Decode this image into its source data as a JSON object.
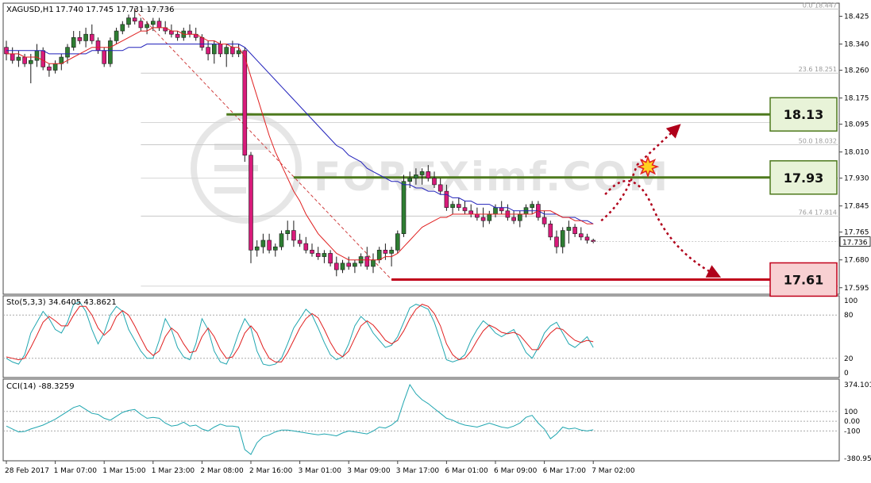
{
  "chart_data": {
    "type": "candlestick",
    "symbol": "XAGUSD,H1",
    "ohlc_header": "17.740 17.745 17.731 17.736",
    "price_axis": {
      "ylim": [
        17.575,
        18.465
      ],
      "ticks": [
        "18.425",
        "18.340",
        "18.260",
        "18.175",
        "18.095",
        "18.010",
        "17.930",
        "17.845",
        "17.765",
        "17.680",
        "17.595"
      ],
      "tick_values": [
        18.425,
        18.34,
        18.26,
        18.175,
        18.095,
        18.01,
        17.93,
        17.845,
        17.765,
        17.68,
        17.595
      ]
    },
    "current_price": {
      "label": "17.736",
      "value": 17.736
    },
    "fibonacci_levels": [
      {
        "label": "0.0  18.447",
        "value": 18.447
      },
      {
        "label": "23.6  18.251",
        "value": 18.251
      },
      {
        "label": "50.0  18.032",
        "value": 18.032
      },
      {
        "label": "76.4  17.814",
        "value": 17.814
      }
    ],
    "key_levels": [
      {
        "label": "18.13",
        "value": 18.125,
        "color": "#4e7a1e",
        "box_bg": "#e8f3d8"
      },
      {
        "label": "17.93",
        "value": 17.932,
        "color": "#4e7a1e",
        "box_bg": "#e8f3d8"
      },
      {
        "label": "17.61",
        "value": 17.62,
        "color": "#c0001a",
        "box_bg": "#f8d0d2"
      }
    ],
    "time_axis": {
      "labels": [
        "28 Feb 2017",
        "1 Mar 07:00",
        "1 Mar 15:00",
        "1 Mar 23:00",
        "2 Mar 08:00",
        "2 Mar 16:00",
        "3 Mar 01:00",
        "3 Mar 09:00",
        "3 Mar 17:00",
        "6 Mar 01:00",
        "6 Mar 09:00",
        "6 Mar 17:00",
        "7 Mar 02:00"
      ],
      "bar_index": [
        0,
        8,
        16,
        24,
        32,
        40,
        48,
        56,
        64,
        72,
        80,
        88,
        96
      ]
    },
    "candles": [
      [
        18.33,
        18.35,
        18.29,
        18.31
      ],
      [
        18.31,
        18.33,
        18.28,
        18.29
      ],
      [
        18.29,
        18.32,
        18.27,
        18.3
      ],
      [
        18.3,
        18.31,
        18.27,
        18.28
      ],
      [
        18.28,
        18.31,
        18.22,
        18.29
      ],
      [
        18.29,
        18.34,
        18.27,
        18.32
      ],
      [
        18.32,
        18.33,
        18.26,
        18.27
      ],
      [
        18.27,
        18.28,
        18.24,
        18.26
      ],
      [
        18.26,
        18.29,
        18.25,
        18.28
      ],
      [
        18.28,
        18.31,
        18.26,
        18.3
      ],
      [
        18.3,
        18.34,
        18.28,
        18.33
      ],
      [
        18.33,
        18.38,
        18.32,
        18.36
      ],
      [
        18.36,
        18.38,
        18.34,
        18.35
      ],
      [
        18.35,
        18.39,
        18.33,
        18.37
      ],
      [
        18.37,
        18.4,
        18.34,
        18.35
      ],
      [
        18.35,
        18.36,
        18.31,
        18.32
      ],
      [
        18.32,
        18.33,
        18.27,
        18.28
      ],
      [
        18.28,
        18.36,
        18.27,
        18.35
      ],
      [
        18.35,
        18.39,
        18.34,
        18.38
      ],
      [
        18.38,
        18.41,
        18.37,
        18.4
      ],
      [
        18.4,
        18.43,
        18.39,
        18.42
      ],
      [
        18.42,
        18.45,
        18.4,
        18.41
      ],
      [
        18.41,
        18.42,
        18.38,
        18.39
      ],
      [
        18.39,
        18.41,
        18.37,
        18.4
      ],
      [
        18.4,
        18.42,
        18.38,
        18.41
      ],
      [
        18.41,
        18.42,
        18.38,
        18.39
      ],
      [
        18.39,
        18.41,
        18.37,
        18.38
      ],
      [
        18.38,
        18.4,
        18.36,
        18.37
      ],
      [
        18.37,
        18.38,
        18.35,
        18.36
      ],
      [
        18.36,
        18.39,
        18.35,
        18.38
      ],
      [
        18.38,
        18.4,
        18.36,
        18.37
      ],
      [
        18.37,
        18.39,
        18.35,
        18.36
      ],
      [
        18.36,
        18.37,
        18.32,
        18.33
      ],
      [
        18.33,
        18.35,
        18.29,
        18.31
      ],
      [
        18.31,
        18.35,
        18.28,
        18.34
      ],
      [
        18.34,
        18.35,
        18.3,
        18.31
      ],
      [
        18.31,
        18.34,
        18.27,
        18.33
      ],
      [
        18.33,
        18.35,
        18.3,
        18.31
      ],
      [
        18.31,
        18.34,
        18.3,
        18.32
      ],
      [
        18.32,
        18.33,
        17.98,
        18.0
      ],
      [
        18.0,
        18.01,
        17.67,
        17.71
      ],
      [
        17.71,
        17.74,
        17.69,
        17.72
      ],
      [
        17.72,
        17.76,
        17.7,
        17.74
      ],
      [
        17.74,
        17.76,
        17.7,
        17.71
      ],
      [
        17.71,
        17.73,
        17.69,
        17.72
      ],
      [
        17.72,
        17.77,
        17.71,
        17.76
      ],
      [
        17.76,
        17.8,
        17.74,
        17.77
      ],
      [
        17.77,
        17.8,
        17.72,
        17.74
      ],
      [
        17.74,
        17.76,
        17.72,
        17.73
      ],
      [
        17.73,
        17.75,
        17.7,
        17.71
      ],
      [
        17.71,
        17.73,
        17.69,
        17.7
      ],
      [
        17.7,
        17.72,
        17.68,
        17.69
      ],
      [
        17.69,
        17.71,
        17.67,
        17.7
      ],
      [
        17.7,
        17.71,
        17.66,
        17.67
      ],
      [
        17.67,
        17.69,
        17.63,
        17.65
      ],
      [
        17.65,
        17.68,
        17.64,
        17.67
      ],
      [
        17.67,
        17.69,
        17.65,
        17.66
      ],
      [
        17.66,
        17.68,
        17.64,
        17.67
      ],
      [
        17.67,
        17.7,
        17.66,
        17.69
      ],
      [
        17.69,
        17.72,
        17.65,
        17.66
      ],
      [
        17.66,
        17.7,
        17.64,
        17.68
      ],
      [
        17.68,
        17.72,
        17.67,
        17.71
      ],
      [
        17.71,
        17.73,
        17.68,
        17.7
      ],
      [
        17.7,
        17.72,
        17.66,
        17.71
      ],
      [
        17.71,
        17.77,
        17.7,
        17.76
      ],
      [
        17.76,
        17.94,
        17.75,
        17.92
      ],
      [
        17.92,
        17.95,
        17.9,
        17.93
      ],
      [
        17.93,
        17.96,
        17.91,
        17.94
      ],
      [
        17.94,
        17.96,
        17.91,
        17.95
      ],
      [
        17.95,
        17.97,
        17.92,
        17.93
      ],
      [
        17.93,
        17.95,
        17.9,
        17.91
      ],
      [
        17.91,
        17.93,
        17.88,
        17.89
      ],
      [
        17.89,
        17.91,
        17.83,
        17.84
      ],
      [
        17.84,
        17.86,
        17.82,
        17.85
      ],
      [
        17.85,
        17.87,
        17.83,
        17.84
      ],
      [
        17.84,
        17.86,
        17.82,
        17.83
      ],
      [
        17.83,
        17.85,
        17.81,
        17.82
      ],
      [
        17.82,
        17.84,
        17.8,
        17.81
      ],
      [
        17.81,
        17.84,
        17.78,
        17.8
      ],
      [
        17.8,
        17.83,
        17.79,
        17.82
      ],
      [
        17.82,
        17.85,
        17.81,
        17.84
      ],
      [
        17.84,
        17.86,
        17.82,
        17.83
      ],
      [
        17.83,
        17.85,
        17.8,
        17.81
      ],
      [
        17.81,
        17.83,
        17.79,
        17.8
      ],
      [
        17.8,
        17.83,
        17.78,
        17.82
      ],
      [
        17.82,
        17.85,
        17.81,
        17.84
      ],
      [
        17.84,
        17.86,
        17.82,
        17.85
      ],
      [
        17.85,
        17.86,
        17.8,
        17.81
      ],
      [
        17.81,
        17.83,
        17.78,
        17.79
      ],
      [
        17.79,
        17.8,
        17.74,
        17.75
      ],
      [
        17.75,
        17.77,
        17.7,
        17.72
      ],
      [
        17.72,
        17.78,
        17.7,
        17.77
      ],
      [
        17.77,
        17.8,
        17.73,
        17.78
      ],
      [
        17.78,
        17.79,
        17.75,
        17.76
      ],
      [
        17.76,
        17.78,
        17.74,
        17.75
      ],
      [
        17.75,
        17.76,
        17.73,
        17.74
      ],
      [
        17.74,
        17.745,
        17.731,
        17.736
      ]
    ],
    "ema_fast": [
      18.31,
      18.31,
      18.31,
      18.3,
      18.3,
      18.3,
      18.29,
      18.28,
      18.28,
      18.28,
      18.29,
      18.3,
      18.31,
      18.32,
      18.33,
      18.33,
      18.33,
      18.33,
      18.34,
      18.35,
      18.36,
      18.37,
      18.38,
      18.38,
      18.39,
      18.39,
      18.39,
      18.38,
      18.38,
      18.37,
      18.37,
      18.37,
      18.36,
      18.35,
      18.35,
      18.34,
      18.34,
      18.33,
      18.33,
      18.3,
      18.24,
      18.18,
      18.12,
      18.06,
      18.01,
      17.97,
      17.93,
      17.89,
      17.86,
      17.82,
      17.79,
      17.76,
      17.74,
      17.72,
      17.7,
      17.69,
      17.68,
      17.68,
      17.68,
      17.68,
      17.68,
      17.68,
      17.69,
      17.69,
      17.7,
      17.72,
      17.74,
      17.76,
      17.78,
      17.79,
      17.8,
      17.81,
      17.81,
      17.82,
      17.82,
      17.82,
      17.82,
      17.82,
      17.82,
      17.82,
      17.82,
      17.82,
      17.82,
      17.82,
      17.82,
      17.82,
      17.82,
      17.83,
      17.83,
      17.83,
      17.82,
      17.81,
      17.81,
      17.8,
      17.8,
      17.79,
      17.79
    ],
    "sma_slow": [
      18.32,
      18.32,
      18.32,
      18.32,
      18.32,
      18.32,
      18.32,
      18.31,
      18.31,
      18.31,
      18.31,
      18.31,
      18.31,
      18.31,
      18.32,
      18.32,
      18.32,
      18.32,
      18.32,
      18.32,
      18.33,
      18.33,
      18.33,
      18.34,
      18.34,
      18.34,
      18.34,
      18.34,
      18.34,
      18.34,
      18.34,
      18.34,
      18.34,
      18.34,
      18.34,
      18.34,
      18.34,
      18.34,
      18.34,
      18.33,
      18.31,
      18.29,
      18.27,
      18.25,
      18.23,
      18.21,
      18.19,
      18.17,
      18.15,
      18.13,
      18.11,
      18.09,
      18.07,
      18.05,
      18.03,
      18.02,
      18.0,
      17.99,
      17.98,
      17.96,
      17.95,
      17.94,
      17.93,
      17.92,
      17.92,
      17.91,
      17.91,
      17.9,
      17.9,
      17.89,
      17.89,
      17.88,
      17.88,
      17.87,
      17.87,
      17.86,
      17.86,
      17.85,
      17.85,
      17.85,
      17.84,
      17.84,
      17.84,
      17.83,
      17.83,
      17.83,
      17.83,
      17.83,
      17.82,
      17.82,
      17.82,
      17.81,
      17.81,
      17.81,
      17.8,
      17.8,
      17.79
    ],
    "stochastic": {
      "label": "Sto(5,3,3) 34.6405 43.8621",
      "ticks": [
        "100",
        "80",
        "20",
        "0"
      ],
      "tick_values": [
        100,
        80,
        20,
        0
      ],
      "main": [
        20,
        15,
        12,
        25,
        55,
        70,
        85,
        75,
        60,
        55,
        70,
        95,
        98,
        85,
        60,
        40,
        55,
        80,
        92,
        85,
        60,
        45,
        30,
        20,
        20,
        45,
        75,
        60,
        35,
        22,
        18,
        40,
        75,
        60,
        30,
        15,
        12,
        30,
        55,
        75,
        62,
        30,
        12,
        10,
        12,
        20,
        40,
        62,
        75,
        88,
        80,
        62,
        42,
        25,
        18,
        22,
        40,
        65,
        78,
        70,
        55,
        45,
        35,
        38,
        50,
        70,
        90,
        95,
        92,
        88,
        70,
        45,
        18,
        15,
        18,
        25,
        45,
        60,
        72,
        65,
        55,
        50,
        55,
        60,
        45,
        28,
        20,
        35,
        55,
        65,
        70,
        55,
        40,
        35,
        42,
        50,
        35
      ],
      "signal": [
        22,
        20,
        18,
        20,
        35,
        52,
        70,
        78,
        72,
        65,
        65,
        80,
        92,
        92,
        80,
        62,
        52,
        60,
        78,
        86,
        80,
        65,
        48,
        32,
        24,
        30,
        50,
        62,
        55,
        40,
        28,
        30,
        50,
        62,
        50,
        32,
        20,
        22,
        35,
        55,
        65,
        55,
        35,
        20,
        15,
        15,
        28,
        45,
        62,
        75,
        82,
        76,
        60,
        42,
        28,
        22,
        30,
        48,
        65,
        72,
        66,
        56,
        45,
        40,
        45,
        58,
        75,
        88,
        95,
        92,
        82,
        65,
        40,
        25,
        18,
        20,
        30,
        45,
        58,
        66,
        62,
        56,
        54,
        56,
        52,
        42,
        32,
        32,
        45,
        55,
        62,
        60,
        52,
        45,
        42,
        45,
        43
      ]
    },
    "cci": {
      "label": "CCI(14) -88.3259",
      "ticks": [
        "374.1016",
        "100",
        "0.00",
        "-100",
        "-380.9541"
      ],
      "tick_values": [
        374.1016,
        100,
        0,
        -100,
        -380.9541
      ],
      "values": [
        -50,
        -80,
        -110,
        -105,
        -80,
        -60,
        -40,
        -10,
        20,
        60,
        100,
        140,
        160,
        120,
        80,
        70,
        30,
        10,
        50,
        90,
        110,
        120,
        70,
        30,
        40,
        30,
        -20,
        -50,
        -40,
        -10,
        -50,
        -40,
        -80,
        -100,
        -60,
        -30,
        -50,
        -50,
        -60,
        -290,
        -340,
        -220,
        -160,
        -140,
        -110,
        -90,
        -90,
        -100,
        -110,
        -120,
        -130,
        -140,
        -130,
        -140,
        -150,
        -120,
        -100,
        -110,
        -120,
        -130,
        -100,
        -60,
        -70,
        -40,
        10,
        200,
        374,
        280,
        220,
        180,
        130,
        80,
        30,
        10,
        -20,
        -40,
        -50,
        -60,
        -40,
        -20,
        -40,
        -60,
        -70,
        -50,
        -20,
        40,
        60,
        -20,
        -80,
        -180,
        -130,
        -60,
        -80,
        -70,
        -90,
        -100,
        -88
      ]
    },
    "annotations": {
      "watermark": "FOREXimf.COM"
    }
  }
}
